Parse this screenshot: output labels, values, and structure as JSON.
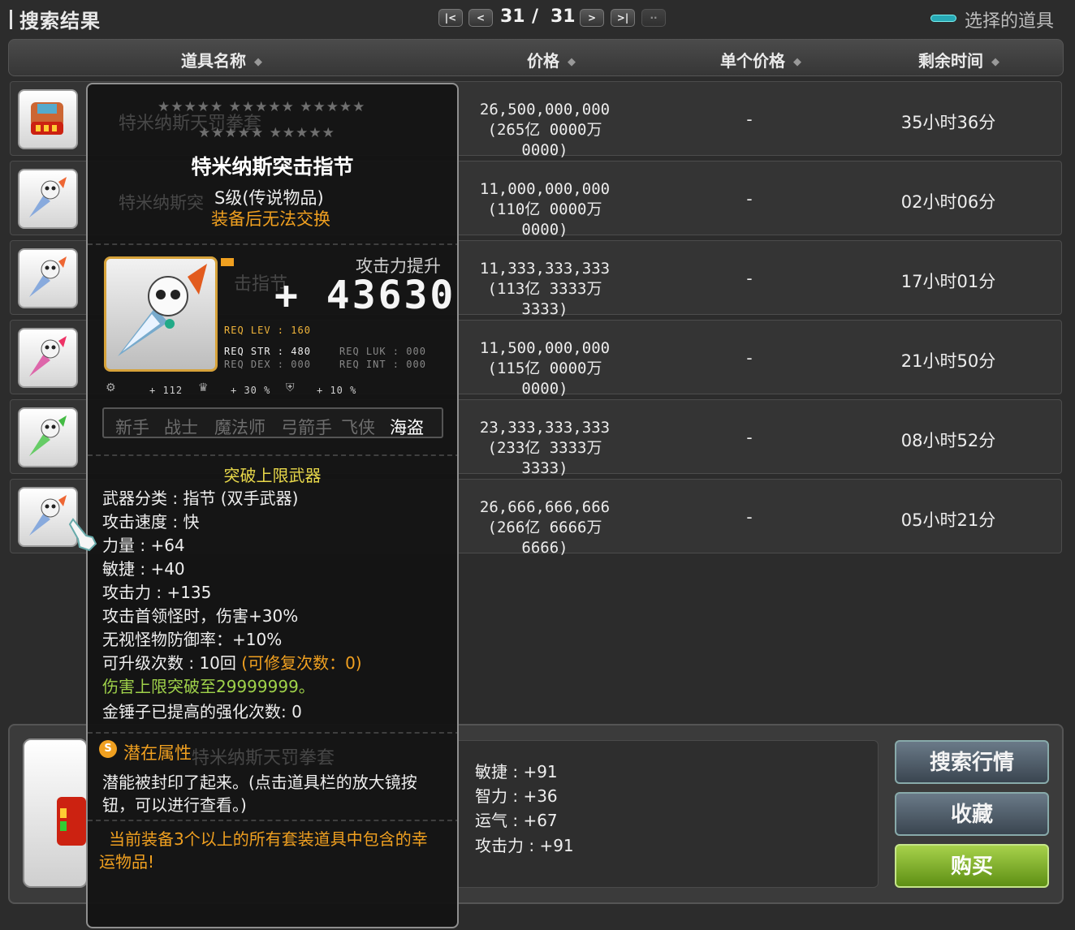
{
  "header": {
    "title": "搜索结果",
    "page_current": "31",
    "page_separator": "/",
    "page_total": "31",
    "selected_label": "选择的道具"
  },
  "columns": {
    "name": "道具名称",
    "price": "价格",
    "unit_price": "单个价格",
    "remaining": "剩余时间"
  },
  "rows": [
    {
      "price": "26,500,000,000",
      "price_detail": "(265亿 0000万 0000)",
      "unit": "-",
      "remaining": "35小时36分"
    },
    {
      "price": "11,000,000,000",
      "price_detail": "(110亿 0000万 0000)",
      "unit": "-",
      "remaining": "02小时06分"
    },
    {
      "price": "11,333,333,333",
      "price_detail": "(113亿 3333万 3333)",
      "unit": "-",
      "remaining": "17小时01分"
    },
    {
      "price": "11,500,000,000",
      "price_detail": "(115亿 0000万 0000)",
      "unit": "-",
      "remaining": "21小时50分"
    },
    {
      "price": "23,333,333,333",
      "price_detail": "(233亿 3333万 3333)",
      "unit": "-",
      "remaining": "08小时52分"
    },
    {
      "price": "26,666,666,666",
      "price_detail": "(266亿 6666万 6666)",
      "unit": "-",
      "remaining": "05小时21分"
    }
  ],
  "tooltip": {
    "stars_row1": "★★★★★ ★★★★★ ★★★★★",
    "stars_row2": "★★★★★ ★★★★★",
    "name": "特米纳斯突击指节",
    "grade": "S级(传说物品)",
    "trade_note": "装备后无法交换",
    "atk_label": "攻击力提升",
    "atk_value": "+ 43630",
    "req_lev": "REQ LEV : 160",
    "req_str": "REQ STR : 480",
    "req_luk": "REQ LUK : 000",
    "req_dex": "REQ DEX : 000",
    "req_int": "REQ INT : 000",
    "bonus1": "+ 112",
    "bonus2": "+ 30 %",
    "bonus3": "+ 10 %",
    "jobs": [
      "新手",
      "战士",
      "魔法师",
      "弓箭手",
      "飞侠",
      "海盗"
    ],
    "limit_break": "突破上限武器",
    "stats": [
      "武器分类 : 指节 (双手武器)",
      "攻击速度 : 快",
      "力量 : +64",
      "敏捷 : +40",
      "攻击力 : +135",
      "攻击首领怪时，伤害+30%",
      "无视怪物防御率：+10%"
    ],
    "upgrade": "可升级次数 : 10回",
    "repair": "(可修复次数：0)",
    "damage_cap": "伤害上限突破至29999999。",
    "hammer": "金锤子已提高的强化次数: 0",
    "potential_title": "潜在属性",
    "potential_text1": "潜能被封印了起来。(点击道具栏的放大镜按",
    "potential_text2": "钮，可以进行查看。)",
    "lucky_text1": "当前装备3个以上的所有套装道具中包含的幸",
    "lucky_text2": "运物品!",
    "ghost_1": "特米纳斯天罚拳套",
    "ghost_2": "特米纳斯突",
    "ghost_3": "击指节",
    "ghost_4": "特米纳斯天罚拳套"
  },
  "stat_panel": [
    "敏捷 : +91",
    "智力 : +36",
    "运气 : +67",
    "攻击力 : +91"
  ],
  "actions": {
    "search_market": "搜索行情",
    "favorite": "收藏",
    "buy": "购买"
  },
  "colors": {
    "accent_orange": "#f0a020",
    "accent_yellow": "#e8d84a",
    "accent_green": "#9fd24a",
    "teal_indicator": "#27a9b5"
  }
}
